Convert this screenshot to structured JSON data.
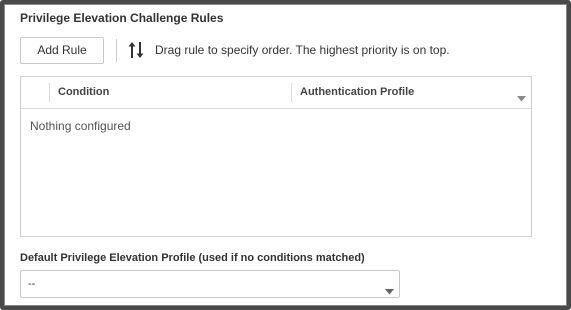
{
  "section": {
    "title": "Privilege Elevation Challenge Rules"
  },
  "toolbar": {
    "add_rule_label": "Add Rule",
    "sort_icon": "sort-arrows-icon",
    "drag_hint": "Drag rule to specify order. The highest priority is on top."
  },
  "rules_table": {
    "columns": [
      "Condition",
      "Authentication Profile"
    ],
    "empty_message": "Nothing configured",
    "column_menu_icon": "chevron-down-icon"
  },
  "default_profile": {
    "label": "Default Privilege Elevation Profile (used if no conditions matched)",
    "selected_value": "--",
    "dropdown_icon": "chevron-down-icon"
  }
}
